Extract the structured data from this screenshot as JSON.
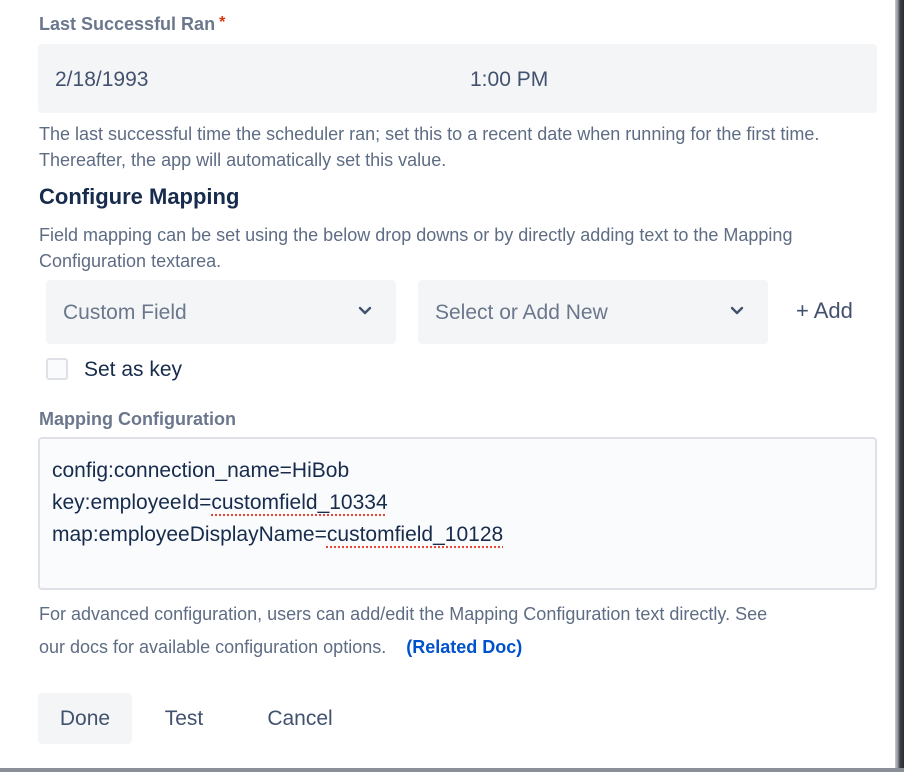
{
  "last_run": {
    "label": "Last Successful Ran",
    "required_mark": "*",
    "date": "2/18/1993",
    "time": "1:00 PM",
    "help": "The last successful time the scheduler ran; set this to a recent date when running for the first time. Thereafter, the app will automatically set this value."
  },
  "mapping": {
    "title": "Configure Mapping",
    "help": "Field mapping can be set using the below drop downs or by directly adding text to the Mapping Configuration textarea.",
    "field_select": "Custom Field",
    "value_select": "Select or Add New",
    "add_label": "+ Add",
    "set_key_label": "Set as key",
    "set_key_checked": false
  },
  "config": {
    "label": "Mapping Configuration",
    "line1": "config:connection_name=HiBob",
    "line2_key": "key:employeeId=",
    "line2_val": "customfield_10334",
    "line3_key": "map:employeeDisplayName=",
    "line3_val": "customfield_10128",
    "help_line1": "For advanced configuration, users can add/edit the Mapping Configuration text directly. See",
    "help_line2": "our docs for available configuration options.",
    "related_link": "(Related Doc)"
  },
  "actions": {
    "done": "Done",
    "test": "Test",
    "cancel": "Cancel"
  }
}
